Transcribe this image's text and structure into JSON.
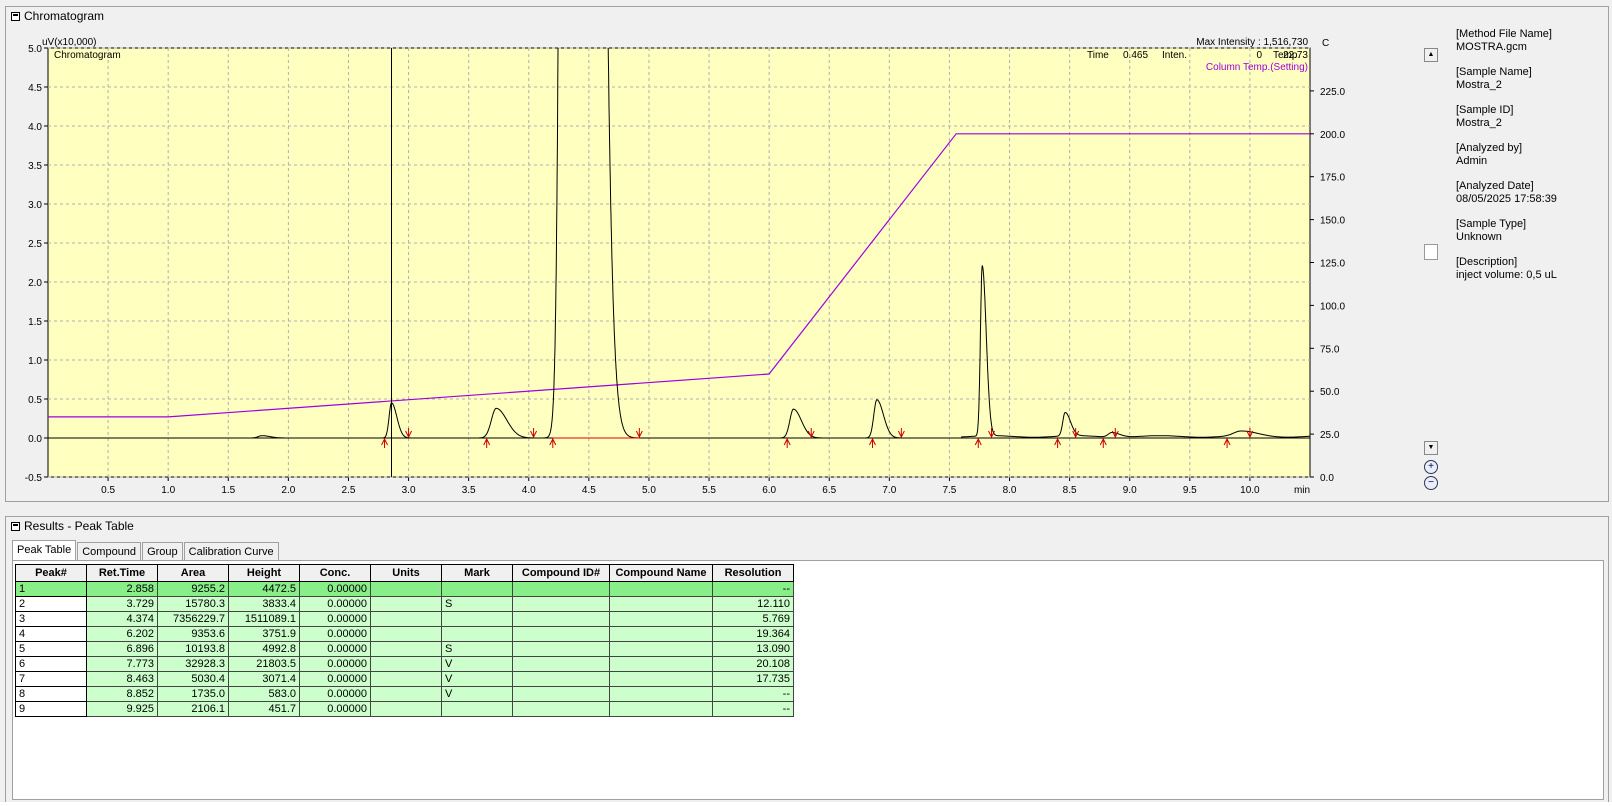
{
  "chromatogram_panel": {
    "title": "Chromatogram"
  },
  "results_panel": {
    "title": "Results - Peak Table"
  },
  "chart_data": {
    "type": "line",
    "title": "Chromatogram",
    "ylabel": "uV(x10,000)",
    "xlabel": "min",
    "xlim": [
      0.0,
      10.5
    ],
    "ylim": [
      -0.5,
      5.0
    ],
    "y2lim": [
      0.0,
      250.0
    ],
    "x_ticks": [
      "0.5",
      "1.0",
      "1.5",
      "2.0",
      "2.5",
      "3.0",
      "3.5",
      "4.0",
      "4.5",
      "5.0",
      "5.5",
      "6.0",
      "6.5",
      "7.0",
      "7.5",
      "8.0",
      "8.5",
      "9.0",
      "9.5",
      "10.0"
    ],
    "y_ticks": [
      "-0.5",
      "0.0",
      "0.5",
      "1.0",
      "1.5",
      "2.0",
      "2.5",
      "3.0",
      "3.5",
      "4.0",
      "4.5",
      "5.0"
    ],
    "y2_ticks": [
      "0.0",
      "25.0",
      "50.0",
      "75.0",
      "100.0",
      "125.0",
      "150.0",
      "175.0",
      "200.0",
      "225.0"
    ],
    "grid": true,
    "max_intensity": "Max Intensity : 1,516,730",
    "cursor": {
      "time_label": "Time",
      "time": "0.465",
      "inten_label": "Inten.",
      "inten": "0",
      "temp_label": "Temp.",
      "temp": "22.73",
      "unit": "C"
    },
    "cursor_x": 2.858,
    "series": [
      {
        "name": "Chromatogram",
        "color": "#000000",
        "peaks": [
          {
            "rt": 1.78,
            "h": 0.03,
            "w": 0.03
          },
          {
            "rt": 2.858,
            "h": 0.45,
            "w": 0.02
          },
          {
            "rt": 3.729,
            "h": 0.38,
            "w": 0.04
          },
          {
            "rt": 4.374,
            "h": 151.1,
            "w": 0.05
          },
          {
            "rt": 6.202,
            "h": 0.37,
            "w": 0.03
          },
          {
            "rt": 6.896,
            "h": 0.49,
            "w": 0.025
          },
          {
            "rt": 7.773,
            "h": 2.18,
            "w": 0.015
          },
          {
            "rt": 8.463,
            "h": 0.3,
            "w": 0.02
          },
          {
            "rt": 8.852,
            "h": 0.06,
            "w": 0.03
          },
          {
            "rt": 9.925,
            "h": 0.06,
            "w": 0.06
          }
        ]
      },
      {
        "name": "Column Temp.(Setting)",
        "color": "#a000e0",
        "points": [
          [
            0.0,
            35.0
          ],
          [
            1.0,
            35.0
          ],
          [
            6.0,
            60.0
          ],
          [
            7.556,
            200.0
          ],
          [
            10.5,
            200.0
          ]
        ]
      }
    ],
    "integration_marks": [
      2.8,
      3.0,
      3.65,
      4.04,
      4.2,
      4.92,
      6.15,
      6.35,
      6.86,
      7.1,
      7.74,
      7.85,
      8.4,
      8.55,
      8.78,
      8.88,
      9.81,
      10.0
    ]
  },
  "sample_info": [
    {
      "label": "[Method File Name]",
      "value": "MOSTRA.gcm"
    },
    {
      "label": "[Sample Name]",
      "value": "Mostra_2"
    },
    {
      "label": "[Sample ID]",
      "value": "Mostra_2"
    },
    {
      "label": "[Analyzed by]",
      "value": "Admin"
    },
    {
      "label": "[Analyzed Date]",
      "value": "08/05/2025 17:58:39"
    },
    {
      "label": "[Sample Type]",
      "value": "Unknown"
    },
    {
      "label": "[Description]",
      "value": "inject volume: 0,5 uL"
    }
  ],
  "tabs": [
    "Peak Table",
    "Compound",
    "Group",
    "Calibration Curve"
  ],
  "peak_table": {
    "columns": [
      "Peak#",
      "Ret.Time",
      "Area",
      "Height",
      "Conc.",
      "Units",
      "Mark",
      "Compound ID#",
      "Compound Name",
      "Resolution"
    ],
    "rows": [
      [
        "1",
        "2.858",
        "9255.2",
        "4472.5",
        "0.00000",
        "",
        "",
        "",
        "",
        "--"
      ],
      [
        "2",
        "3.729",
        "15780.3",
        "3833.4",
        "0.00000",
        "",
        "S",
        "",
        "",
        "12.110"
      ],
      [
        "3",
        "4.374",
        "7356229.7",
        "1511089.1",
        "0.00000",
        "",
        "",
        "",
        "",
        "5.769"
      ],
      [
        "4",
        "6.202",
        "9353.6",
        "3751.9",
        "0.00000",
        "",
        "",
        "",
        "",
        "19.364"
      ],
      [
        "5",
        "6.896",
        "10193.8",
        "4992.8",
        "0.00000",
        "",
        "S",
        "",
        "",
        "13.090"
      ],
      [
        "6",
        "7.773",
        "32928.3",
        "21803.5",
        "0.00000",
        "",
        " V",
        "",
        "",
        "20.108"
      ],
      [
        "7",
        "8.463",
        "5030.4",
        "3071.4",
        "0.00000",
        "",
        " V",
        "",
        "",
        "17.735"
      ],
      [
        "8",
        "8.852",
        "1735.0",
        "583.0",
        "0.00000",
        "",
        " V",
        "",
        "",
        "--"
      ],
      [
        "9",
        "9.925",
        "2106.1",
        "451.7",
        "0.00000",
        "",
        "",
        "",
        "",
        "--"
      ]
    ]
  }
}
